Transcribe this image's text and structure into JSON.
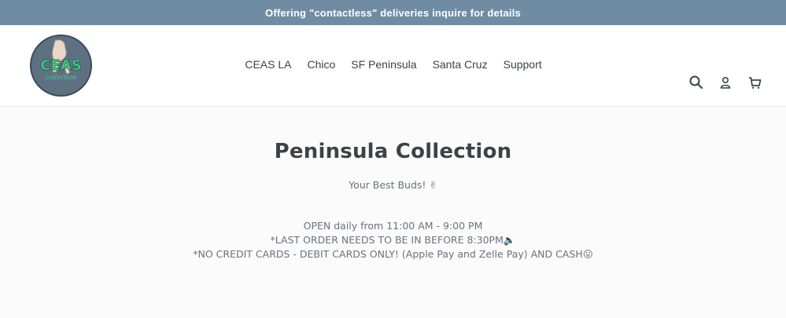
{
  "announcement": "Offering \"contactless\" deliveries inquire for details",
  "logo": {
    "text_main": "CEAS",
    "text_sub": "collection"
  },
  "nav": {
    "items": [
      {
        "label": "CEAS LA"
      },
      {
        "label": "Chico"
      },
      {
        "label": "SF Peninsula"
      },
      {
        "label": "Santa Cruz"
      },
      {
        "label": "Support"
      }
    ]
  },
  "header_icons": [
    "search-icon",
    "account-icon",
    "cart-icon"
  ],
  "page": {
    "title": "Peninsula Collection",
    "subtitle": "Your Best Buds! ✌",
    "info_lines": [
      "OPEN daily from 11:00 AM - 9:00 PM",
      "*LAST ORDER NEEDS TO BE IN BEFORE 8:30PM🔈",
      "*NO CREDIT CARDS - DEBIT CARDS ONLY! (Apple Pay and Zelle Pay) AND CASH😛"
    ]
  },
  "colors": {
    "announcement_bg": "#6f8ca3",
    "logo_bg": "#5e7183",
    "logo_text": "#3fd48a",
    "text": "#3d4246"
  }
}
